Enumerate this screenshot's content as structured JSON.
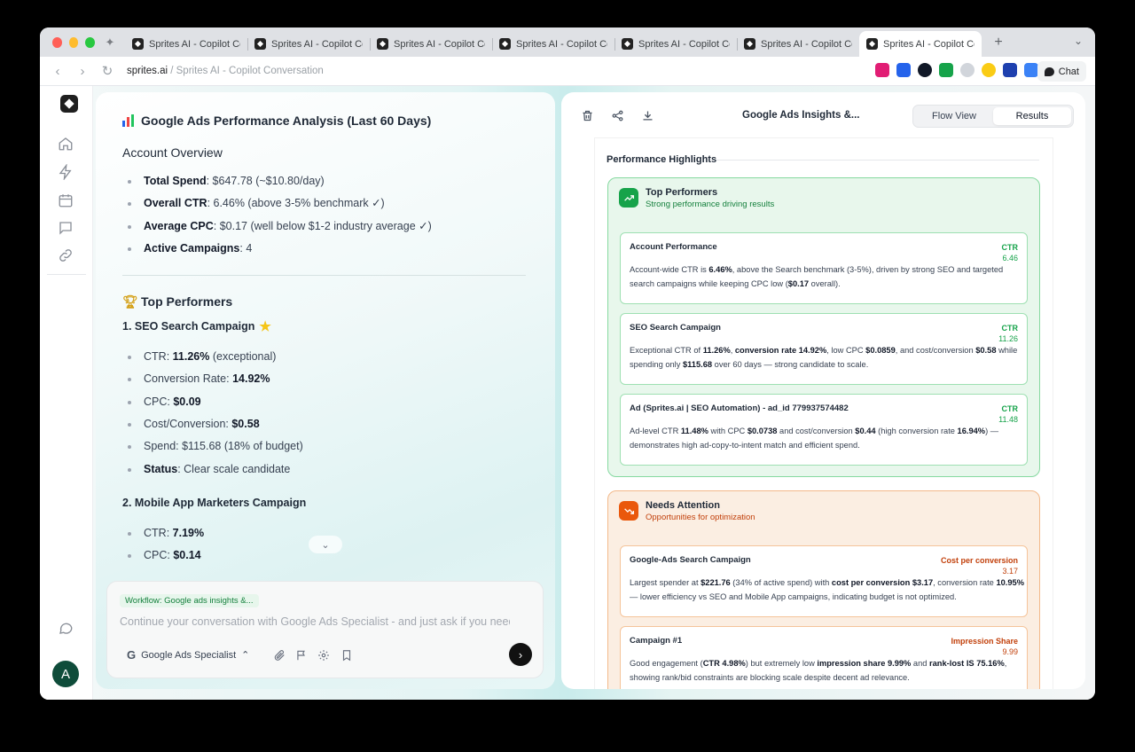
{
  "browser": {
    "tabs": [
      {
        "title": "Sprites AI - Copilot Conversation"
      },
      {
        "title": "Sprites AI - Copilot Conversation"
      },
      {
        "title": "Sprites AI - Copilot Conversation"
      },
      {
        "title": "Sprites AI - Copilot Conversation"
      },
      {
        "title": "Sprites AI - Copilot Conversation"
      },
      {
        "title": "Sprites AI - Copilot Conversation"
      },
      {
        "title": "Sprites AI - Copilot Conversation"
      }
    ],
    "new_tab": "+",
    "url_domain": "sprites.ai",
    "url_sep": " / ",
    "url_page": "Sprites AI - Copilot Conversation",
    "chat_label": "Chat",
    "extension_colors": [
      "#e11d74",
      "#2563eb",
      "#111827",
      "#16a34a",
      "#9ca3af",
      "#facc15",
      "#1e40af",
      "#2563eb"
    ]
  },
  "rail": {
    "avatar_letter": "A",
    "icons": [
      "home-icon",
      "bolt-icon",
      "calendar-icon",
      "chat-icon",
      "link-icon",
      "message-icon"
    ]
  },
  "chat": {
    "title": "Google Ads Performance Analysis (Last 60 Days)",
    "overview_heading": "Account Overview",
    "overview": [
      {
        "label": "Total Spend",
        "value": ": $647.78 (~$10.80/day)"
      },
      {
        "label": "Overall CTR",
        "value": ": 6.46% (above 3-5% benchmark ✓)"
      },
      {
        "label": "Average CPC",
        "value": ": $0.17 (well below $1-2 industry average ✓)"
      },
      {
        "label": "Active Campaigns",
        "value": ": 4"
      }
    ],
    "top_heading": "Top Performers",
    "campaign1_title": "1. SEO Search Campaign",
    "campaign1": {
      "ctr_label": "CTR: ",
      "ctr_value": "11.26%",
      "ctr_note": " (exceptional)",
      "conv_label": "Conversion Rate: ",
      "conv_value": "14.92%",
      "cpc_label": "CPC: ",
      "cpc_value": "$0.09",
      "cost_label": "Cost/Conversion: ",
      "cost_value": "$0.58",
      "spend_text": "Spend: $115.68 (18% of budget)",
      "status_label": "Status",
      "status_value": ": Clear scale candidate"
    },
    "campaign2_title": "2. Mobile App Marketers Campaign",
    "campaign2": {
      "ctr_label": "CTR: ",
      "ctr_value": "7.19%",
      "cpc_label": "CPC: ",
      "cpc_value": "$0.14"
    },
    "scroll_glyph": "⌄",
    "composer": {
      "workflow_chip": "Workflow: Google ads insights &...",
      "placeholder": "Continue your conversation with Google Ads Specialist - and just ask if you need help",
      "agent_logo": "G",
      "agent_name": "Google Ads Specialist",
      "agent_caret": "⌃",
      "send_glyph": "›"
    }
  },
  "results": {
    "title": "Google Ads Insights &...",
    "view_tabs": {
      "flow": "Flow View",
      "results": "Results"
    },
    "section_title": "Performance Highlights",
    "top": {
      "title": "Top Performers",
      "subtitle": "Strong performance driving results",
      "cards": [
        {
          "name": "Account Performance",
          "metric_label": "CTR",
          "metric_value": "6.46",
          "text": [
            {
              "t": "Account-wide CTR is "
            },
            {
              "t": "6.46%",
              "b": true
            },
            {
              "t": ", above the Search benchmark (3-5%), driven by strong SEO and targeted search campaigns while keeping CPC low ("
            },
            {
              "t": "$0.17",
              "b": true
            },
            {
              "t": " overall)."
            }
          ]
        },
        {
          "name": "SEO Search Campaign",
          "metric_label": "CTR",
          "metric_value": "11.26",
          "text": [
            {
              "t": "Exceptional CTR of "
            },
            {
              "t": "11.26%",
              "b": true
            },
            {
              "t": ", "
            },
            {
              "t": "conversion rate 14.92%",
              "b": true
            },
            {
              "t": ", low CPC "
            },
            {
              "t": "$0.0859",
              "b": true
            },
            {
              "t": ", and cost/conversion "
            },
            {
              "t": "$0.58",
              "b": true
            },
            {
              "t": " while spending only "
            },
            {
              "t": "$115.68",
              "b": true
            },
            {
              "t": " over 60 days — strong candidate to scale."
            }
          ]
        },
        {
          "name": "Ad (Sprites.ai | SEO Automation) - ad_id 779937574482",
          "metric_label": "CTR",
          "metric_value": "11.48",
          "text": [
            {
              "t": "Ad-level CTR "
            },
            {
              "t": "11.48%",
              "b": true
            },
            {
              "t": " with CPC "
            },
            {
              "t": "$0.0738",
              "b": true
            },
            {
              "t": " and cost/conversion "
            },
            {
              "t": "$0.44",
              "b": true
            },
            {
              "t": " (high conversion rate "
            },
            {
              "t": "16.94%",
              "b": true
            },
            {
              "t": ") — demonstrates high ad-copy-to-intent match and efficient spend."
            }
          ]
        }
      ]
    },
    "attention": {
      "title": "Needs Attention",
      "subtitle": "Opportunities for optimization",
      "cards": [
        {
          "name": "Google-Ads Search Campaign",
          "metric_label": "Cost per conversion",
          "metric_value": "3.17",
          "text": [
            {
              "t": "Largest spender at "
            },
            {
              "t": "$221.76",
              "b": true
            },
            {
              "t": " (34% of active spend) with "
            },
            {
              "t": "cost per conversion $3.17",
              "b": true
            },
            {
              "t": ", conversion rate "
            },
            {
              "t": "10.95%",
              "b": true
            },
            {
              "t": " — lower efficiency vs SEO and Mobile App campaigns, indicating budget is not optimized."
            }
          ]
        },
        {
          "name": "Campaign #1",
          "metric_label": "Impression Share",
          "metric_value": "9.99",
          "text": [
            {
              "t": "Good engagement ("
            },
            {
              "t": "CTR 4.98%",
              "b": true
            },
            {
              "t": ") but extremely low "
            },
            {
              "t": "impression share 9.99%",
              "b": true
            },
            {
              "t": " and "
            },
            {
              "t": "rank-lost IS 75.16%",
              "b": true
            },
            {
              "t": ", showing rank/bid constraints are blocking scale despite decent ad relevance."
            }
          ]
        }
      ]
    }
  }
}
